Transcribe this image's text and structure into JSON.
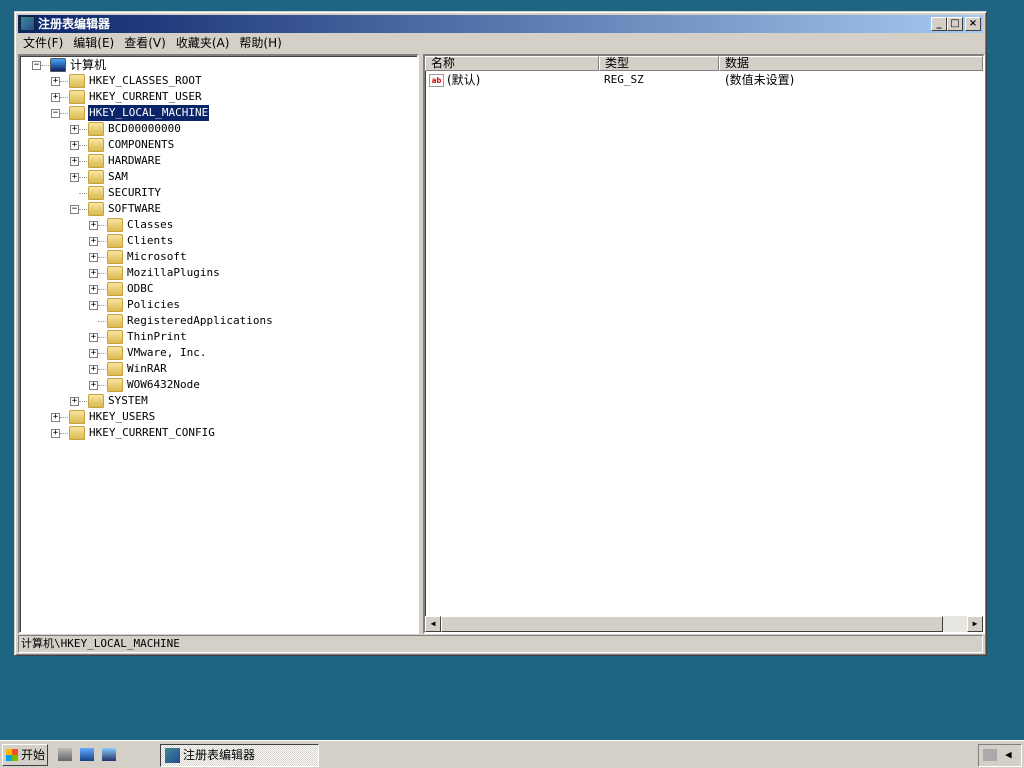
{
  "window": {
    "title": "注册表编辑器"
  },
  "menu": [
    "文件(F)",
    "编辑(E)",
    "查看(V)",
    "收藏夹(A)",
    "帮助(H)"
  ],
  "tree": [
    {
      "label": "计算机",
      "level": 0,
      "exp": "-",
      "icon": "computer"
    },
    {
      "label": "HKEY_CLASSES_ROOT",
      "level": 1,
      "exp": "+"
    },
    {
      "label": "HKEY_CURRENT_USER",
      "level": 1,
      "exp": "+"
    },
    {
      "label": "HKEY_LOCAL_MACHINE",
      "level": 1,
      "exp": "-",
      "selected": true
    },
    {
      "label": "BCD00000000",
      "level": 2,
      "exp": "+"
    },
    {
      "label": "COMPONENTS",
      "level": 2,
      "exp": "+"
    },
    {
      "label": "HARDWARE",
      "level": 2,
      "exp": "+"
    },
    {
      "label": "SAM",
      "level": 2,
      "exp": "+"
    },
    {
      "label": "SECURITY",
      "level": 2,
      "exp": ""
    },
    {
      "label": "SOFTWARE",
      "level": 2,
      "exp": "-"
    },
    {
      "label": "Classes",
      "level": 3,
      "exp": "+"
    },
    {
      "label": "Clients",
      "level": 3,
      "exp": "+"
    },
    {
      "label": "Microsoft",
      "level": 3,
      "exp": "+"
    },
    {
      "label": "MozillaPlugins",
      "level": 3,
      "exp": "+"
    },
    {
      "label": "ODBC",
      "level": 3,
      "exp": "+"
    },
    {
      "label": "Policies",
      "level": 3,
      "exp": "+"
    },
    {
      "label": "RegisteredApplications",
      "level": 3,
      "exp": ""
    },
    {
      "label": "ThinPrint",
      "level": 3,
      "exp": "+"
    },
    {
      "label": "VMware, Inc.",
      "level": 3,
      "exp": "+"
    },
    {
      "label": "WinRAR",
      "level": 3,
      "exp": "+"
    },
    {
      "label": "WOW6432Node",
      "level": 3,
      "exp": "+"
    },
    {
      "label": "SYSTEM",
      "level": 2,
      "exp": "+"
    },
    {
      "label": "HKEY_USERS",
      "level": 1,
      "exp": "+"
    },
    {
      "label": "HKEY_CURRENT_CONFIG",
      "level": 1,
      "exp": "+"
    }
  ],
  "list": {
    "columns": [
      "名称",
      "类型",
      "数据"
    ],
    "rows": [
      {
        "name": "(默认)",
        "type": "REG_SZ",
        "data": "(数值未设置)",
        "icon": "ab"
      }
    ]
  },
  "status": "计算机\\HKEY_LOCAL_MACHINE",
  "taskbar": {
    "start": "开始",
    "task": "注册表编辑器"
  }
}
